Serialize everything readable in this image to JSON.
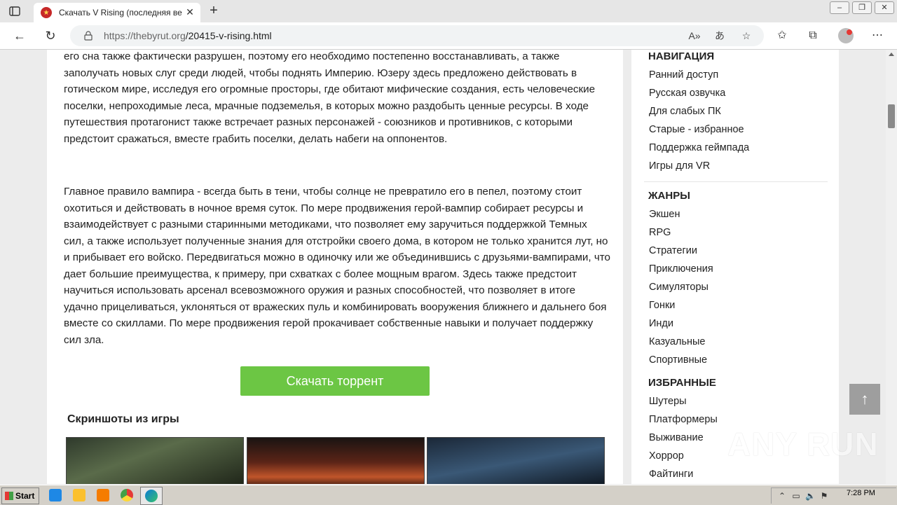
{
  "browser": {
    "tab_title": "Скачать V Rising (последняя вер",
    "url_host": "https://thebyrut.org",
    "url_path": "/20415-v-rising.html"
  },
  "article": {
    "paragraph1": "его сна также фактически разрушен, поэтому его необходимо постепенно восстанавливать, а также заполучать новых слуг среди людей, чтобы поднять Империю. Юзеру здесь предложено действовать в готическом мире, исследуя его огромные просторы, где обитают мифические создания, есть человеческие поселки, непроходимые леса, мрачные подземелья, в которых можно раздобыть ценные ресурсы. В ходе путешествия протагонист также встречает разных персонажей - союзников и противников, с которыми предстоит сражаться, вместе грабить поселки, делать набеги на оппонентов.",
    "paragraph2": "Главное правило вампира - всегда быть в тени, чтобы солнце не превратило его в пепел, поэтому стоит охотиться и действовать в ночное время суток. По мере продвижения герой-вампир собирает ресурсы и взаимодействует с разными старинными методиками, что позволяет ему заручиться поддержкой Темных сил, а также использует полученные знания для отстройки своего дома, в котором не только хранится лут, но и прибывает его войско. Передвигаться можно в одиночку или же объединившись с друзьями-вампирами, что дает большие преимущества, к примеру, при схватках с более мощным врагом. Здесь также предстоит научиться использовать арсенал всевозможного оружия и разных способностей, что позволяет в итоге удачно прицеливаться, уклоняться от вражеских пуль и комбинировать вооружения ближнего и дальнего боя вместе со скиллами. По мере продвижения герой прокачивает собственные навыки и получает поддержку сил зла.",
    "download_button": "Скачать торрент",
    "screenshots_title": "Скриншоты из игры"
  },
  "sidebar": {
    "nav_heading": "НАВИГАЦИЯ",
    "nav_items": [
      "Ранний доступ",
      "Русская озвучка",
      "Для слабых ПК",
      "Старые - избранное",
      "Поддержка геймпада",
      "Игры для VR"
    ],
    "genres_heading": "ЖАНРЫ",
    "genre_items": [
      "Экшен",
      "RPG",
      "Стратегии",
      "Приключения",
      "Симуляторы",
      "Гонки",
      "Инди",
      "Казуальные",
      "Спортивные"
    ],
    "favorites_heading": "ИЗБРАННЫЕ",
    "favorite_items": [
      "Шутеры",
      "Платформеры",
      "Выживание",
      "Хоррор",
      "Файтинги"
    ]
  },
  "watermark": "ANY RUN",
  "taskbar": {
    "start_label": "Start",
    "clock": "7:28 PM"
  },
  "colors": {
    "download_button": "#6cc644",
    "scroll_top": "#9e9e9e"
  }
}
